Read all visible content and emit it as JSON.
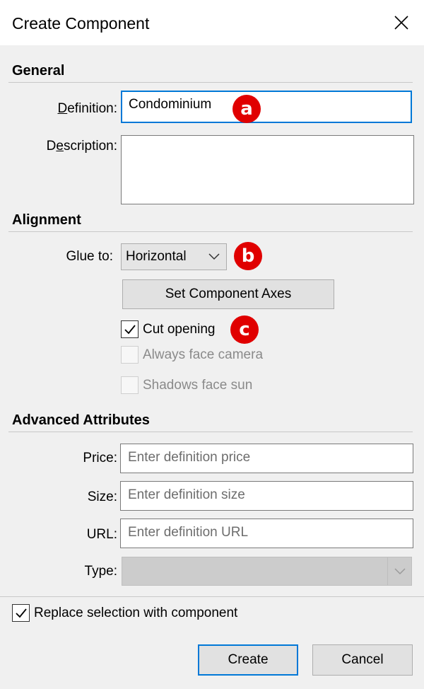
{
  "window": {
    "title": "Create Component"
  },
  "general": {
    "section_title": "General",
    "definition_label_u": "D",
    "definition_label_rest": "efinition:",
    "definition_value": "Condominium",
    "description_label_pre": "D",
    "description_label_u": "e",
    "description_label_rest": "scription:",
    "description_value": ""
  },
  "alignment": {
    "section_title": "Alignment",
    "glue_label": "Glue to:",
    "glue_value": "Horizontal",
    "set_axes_label": "Set Component Axes",
    "cut_opening_label": "Cut opening",
    "cut_opening_checked": true,
    "always_face_camera_label": "Always face camera",
    "shadows_face_sun_label": "Shadows face sun"
  },
  "advanced": {
    "section_title": "Advanced Attributes",
    "price_label": "Price:",
    "price_placeholder": "Enter definition price",
    "size_label": "Size:",
    "size_placeholder": "Enter definition size",
    "url_label": "URL:",
    "url_placeholder": "Enter definition URL",
    "type_label": "Type:"
  },
  "footer": {
    "replace_label": "Replace selection with component",
    "replace_checked": true,
    "create_label": "Create",
    "cancel_label": "Cancel"
  },
  "badges": {
    "a": "a",
    "b": "b",
    "c": "c"
  },
  "colors": {
    "badge": "#e00000",
    "focus": "#0078d7"
  }
}
